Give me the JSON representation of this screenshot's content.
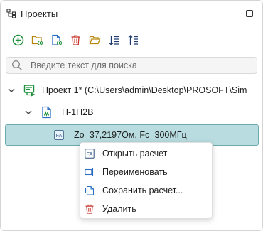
{
  "panel": {
    "title": "Проекты"
  },
  "toolbar": {
    "buttons": [
      "add-icon",
      "folder-add-icon",
      "file-add-icon",
      "delete-icon",
      "folder-open-icon",
      "sort-icon",
      "sort-alt-icon"
    ]
  },
  "search": {
    "placeholder": "Введите текст для поиска",
    "value": ""
  },
  "tree": {
    "project": {
      "label": "Проект 1* (C:\\Users\\admin\\Desktop\\PROSOFT\\Sim",
      "icon": "project-icon"
    },
    "node": {
      "label": "П-1Н2В",
      "icon": "element-icon"
    },
    "calc": {
      "label": "Zo=37,2197Ом, Fc=300МГц",
      "icon": "calc-file-icon",
      "badge": "FA"
    }
  },
  "context_menu": {
    "items": [
      {
        "label": "Открыть расчет",
        "icon": "open-calc-icon"
      },
      {
        "label": "Переименовать",
        "icon": "rename-icon"
      },
      {
        "label": "Сохранить расчет...",
        "icon": "save-icon"
      },
      {
        "label": "Удалить",
        "icon": "delete-icon"
      }
    ]
  },
  "colors": {
    "accent_green": "#1e8f3a",
    "accent_blue": "#2b6fc2",
    "accent_red": "#c8342a",
    "selection_bg": "#b8dcdf",
    "selection_border": "#6fa9ad"
  }
}
